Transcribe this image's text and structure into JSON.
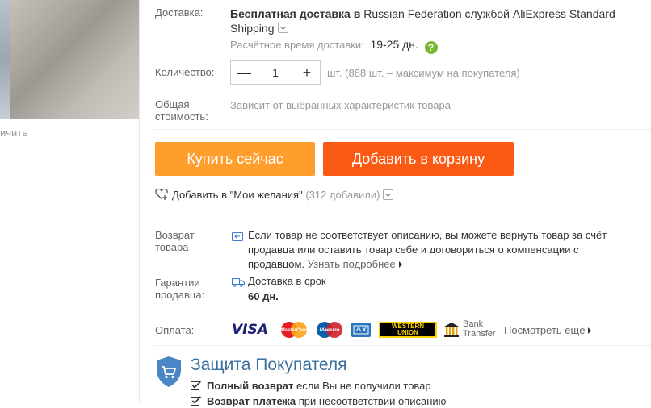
{
  "left": {
    "compare_label": "ичить"
  },
  "shipping": {
    "label": "Доставка:",
    "free_prefix": "Бесплатная доставка",
    "in_word": "в",
    "country": "Russian Federation",
    "by_word": "службой",
    "service": "AliExpress Standard Shipping",
    "eta_label": "Расчётное время доставки:",
    "eta_value": "19-25 дн."
  },
  "quantity": {
    "label": "Количество:",
    "value": "1",
    "minus": "—",
    "plus": "+",
    "note": "шт. (888 шт. – максимум на покупателя)"
  },
  "total": {
    "label_line1": "Общая",
    "label_line2": "стоимость:",
    "value": "Зависит от выбранных характеристик товара"
  },
  "buttons": {
    "buy_now": "Купить сейчас",
    "add_to_cart": "Добавить в корзину"
  },
  "wishlist": {
    "label": "Добавить в \"Мои желания\"",
    "count": "(312 добавили)"
  },
  "returns": {
    "label_line1": "Возврат",
    "label_line2": "товара",
    "text": "Если товар не соответствует описанию, вы можете вернуть товар за счёт продавца или оставить товар себе и договориться о компенсации с продавцом.",
    "more": "Узнать подробнее"
  },
  "guarantee": {
    "label_line1": "Гарантии",
    "label_line2": "продавца:",
    "line1": "Доставка в срок",
    "line2": "60 дн."
  },
  "payment": {
    "label": "Оплата:",
    "visa": "VISA",
    "mastercard": "MasterCard",
    "maestro": "Maestro",
    "wu_line1": "WESTERN",
    "wu_line2": "UNION",
    "bank_line1": "Bank",
    "bank_line2": "Transfer",
    "see_more": "Посмотреть ещё"
  },
  "protection": {
    "title": "Защита Покупателя",
    "item1_bold": "Полный возврат",
    "item1_rest": "если Вы не получили товар",
    "item2_bold": "Возврат платежа",
    "item2_rest": "при несоответствии описанию"
  },
  "colors": {
    "buy_now": "#ff9e2c",
    "add_to_cart": "#fa5a14",
    "help_icon": "#7ab730",
    "protection_title": "#3a6fa0"
  }
}
